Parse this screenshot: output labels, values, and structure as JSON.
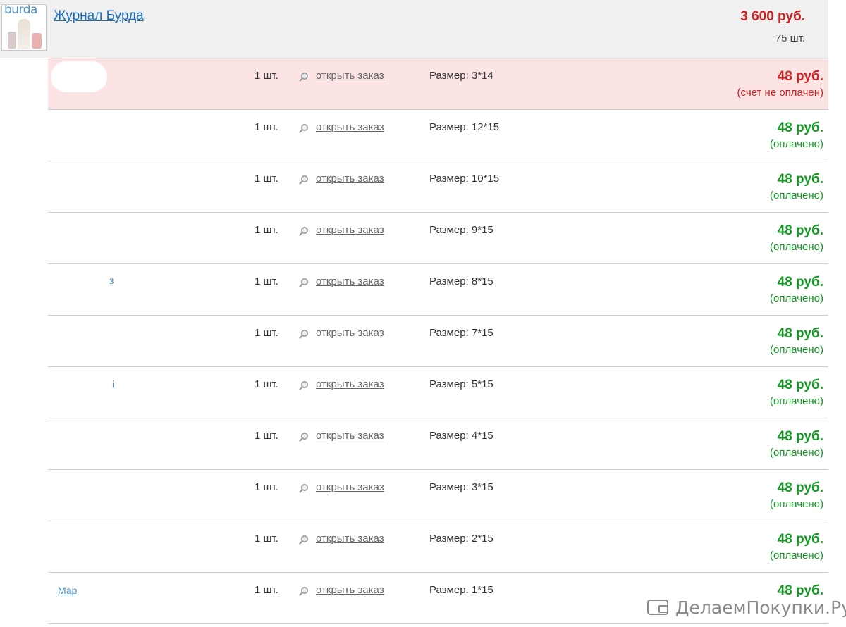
{
  "product": {
    "logo_text": "burda",
    "title": "Журнал Бурда",
    "total_price": "3 600 руб.",
    "total_qty": "75 шт."
  },
  "orders": [
    {
      "qty": "1 шт.",
      "link": "открыть заказ",
      "size": "Размер: 3*14",
      "price": "48 руб.",
      "status": "(счет не оплачен)",
      "paid": false
    },
    {
      "qty": "1 шт.",
      "link": "открыть заказ",
      "size": "Размер: 12*15",
      "price": "48 руб.",
      "status": "(оплачено)",
      "paid": true
    },
    {
      "qty": "1 шт.",
      "link": "открыть заказ",
      "size": "Размер: 10*15",
      "price": "48 руб.",
      "status": "(оплачено)",
      "paid": true
    },
    {
      "qty": "1 шт.",
      "link": "открыть заказ",
      "size": "Размер: 9*15",
      "price": "48 руб.",
      "status": "(оплачено)",
      "paid": true
    },
    {
      "qty": "1 шт.",
      "link": "открыть заказ",
      "size": "Размер: 8*15",
      "price": "48 руб.",
      "status": "(оплачено)",
      "paid": true
    },
    {
      "qty": "1 шт.",
      "link": "открыть заказ",
      "size": "Размер: 7*15",
      "price": "48 руб.",
      "status": "(оплачено)",
      "paid": true
    },
    {
      "qty": "1 шт.",
      "link": "открыть заказ",
      "size": "Размер: 5*15",
      "price": "48 руб.",
      "status": "(оплачено)",
      "paid": true
    },
    {
      "qty": "1 шт.",
      "link": "открыть заказ",
      "size": "Размер: 4*15",
      "price": "48 руб.",
      "status": "(оплачено)",
      "paid": true
    },
    {
      "qty": "1 шт.",
      "link": "открыть заказ",
      "size": "Размер: 3*15",
      "price": "48 руб.",
      "status": "(оплачено)",
      "paid": true
    },
    {
      "qty": "1 шт.",
      "link": "открыть заказ",
      "size": "Размер: 2*15",
      "price": "48 руб.",
      "status": "(оплачено)",
      "paid": true
    },
    {
      "qty": "1 шт.",
      "link": "открыть заказ",
      "size": "Размер: 1*15",
      "price": "48 руб.",
      "status": "",
      "paid": true
    }
  ],
  "fragments": {
    "row5": "з",
    "row7": "i",
    "row11": "Мар"
  },
  "watermark": {
    "text": "ДелаемПокупки.Ру"
  },
  "colors": {
    "paid": "#119922",
    "unpaid": "#cc2222",
    "unpaid_bg": "#fde4e4",
    "link": "#1a6fbd"
  }
}
